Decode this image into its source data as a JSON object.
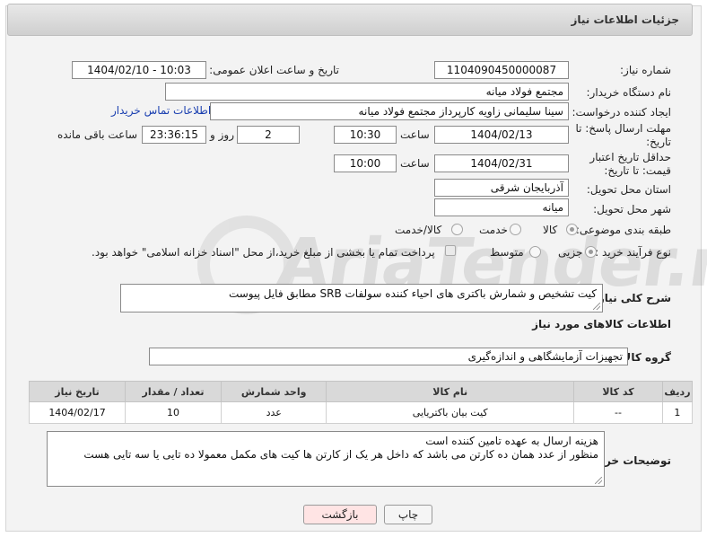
{
  "header": {
    "title": "جزئیات اطلاعات نیاز"
  },
  "need_number": {
    "label": "شماره نیاز:",
    "value": "1104090450000087"
  },
  "announce": {
    "label": "تاریخ و ساعت اعلان عمومی:",
    "value": "1404/02/10 - 10:03"
  },
  "buyer_org": {
    "label": "نام دستگاه خریدار:",
    "value": "مجتمع فولاد میانه"
  },
  "creator": {
    "label": "ایجاد کننده درخواست:",
    "value": "سینا سلیمانی زاویه کارپرداز مجتمع فولاد میانه",
    "contact_link": "اطلاعات تماس خریدار"
  },
  "reply_deadline": {
    "label": "مهلت ارسال پاسخ: تا تاریخ:",
    "date": "1404/02/13",
    "time_label": "ساعت",
    "time": "10:30",
    "days": "2",
    "days_label": "روز و",
    "remaining": "23:36:15",
    "remaining_label": "ساعت باقی مانده"
  },
  "price_validity": {
    "label": "حداقل تاریخ اعتبار قیمت: تا تاریخ:",
    "date": "1404/02/31",
    "time_label": "ساعت",
    "time": "10:00"
  },
  "delivery_province": {
    "label": "استان محل تحویل:",
    "value": "آذربایجان شرقی"
  },
  "delivery_city": {
    "label": "شهر محل تحویل:",
    "value": "میانه"
  },
  "category": {
    "label": "طبقه بندی موضوعی:",
    "options": [
      "کالا",
      "خدمت",
      "کالا/خدمت"
    ],
    "selected": "کالا"
  },
  "process": {
    "label": "نوع فرآیند خرید :",
    "options": [
      "جزیی",
      "متوسط"
    ],
    "selected": "جزیی",
    "payment_note": "پرداخت تمام یا بخشی از مبلغ خرید،از محل \"اسناد خزانه اسلامی\" خواهد بود."
  },
  "description": {
    "label": "شرح کلی نیاز:",
    "value": "کیت تشخیص و شمارش باکتری های احیاء کننده سولفات SRB  مطابق فایل پیوست"
  },
  "goods_info": {
    "title": "اطلاعات کالاهای مورد نیاز"
  },
  "goods_group": {
    "label": "گروه کالا:",
    "value": "تجهیزات آزمایشگاهی و اندازه‌گیری"
  },
  "table": {
    "columns": [
      "ردیف",
      "کد کالا",
      "نام کالا",
      "واحد شمارش",
      "تعداد / مقدار",
      "تاریخ نیاز"
    ],
    "rows": [
      {
        "row": "1",
        "code": "--",
        "name": "کیت بیان باکتریایی",
        "unit": "عدد",
        "qty": "10",
        "date": "1404/02/17"
      }
    ]
  },
  "buyer_notes": {
    "label": "توضیحات خریدار:",
    "line1": "هزینه ارسال به عهده تامین کننده است",
    "line2": "منظور از عدد همان ده کارتن می باشد که داخل هر یک از کارتن ها کیت های مکمل معمولا ده تایی یا سه تایی هست"
  },
  "buttons": {
    "back": "بازگشت",
    "print": "چاپ"
  },
  "watermark": {
    "text": "AriaTender.neT"
  },
  "colors": {
    "link": "#1a3fb0",
    "back_button": "#ffe4e4",
    "header": "#d6d6d6"
  }
}
